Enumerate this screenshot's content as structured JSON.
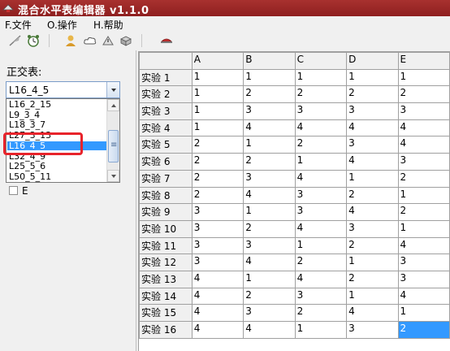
{
  "window": {
    "title": "混合水平表编辑器 v1.1.0"
  },
  "menu": [
    {
      "label": "F.文件"
    },
    {
      "label": "O.操作"
    },
    {
      "label": "H.帮助"
    }
  ],
  "toolbar": {
    "icons": [
      "feather-icon",
      "alarm-clock-icon",
      "user-icon",
      "cloud-icon",
      "warning-icon",
      "box-icon",
      "cap-icon"
    ]
  },
  "left_panel": {
    "label": "正交表:",
    "combo_value": "L16_4_5",
    "dropdown_items": [
      "L16_2_15",
      "L9_3_4",
      "L18_3_7",
      "L27_3_13",
      "L16_4_5",
      "L32_4_9",
      "L25_5_6",
      "L50_5_11"
    ],
    "dropdown_selected": "L16_4_5",
    "checkbox_label": "E",
    "checkbox_checked": false
  },
  "grid": {
    "columns": [
      "A",
      "B",
      "C",
      "D",
      "E"
    ],
    "rows": [
      {
        "label": "实验 1",
        "values": [
          "1",
          "1",
          "1",
          "1",
          "1"
        ]
      },
      {
        "label": "实验 2",
        "values": [
          "1",
          "2",
          "2",
          "2",
          "2"
        ]
      },
      {
        "label": "实验 3",
        "values": [
          "1",
          "3",
          "3",
          "3",
          "3"
        ]
      },
      {
        "label": "实验 4",
        "values": [
          "1",
          "4",
          "4",
          "4",
          "4"
        ]
      },
      {
        "label": "实验 5",
        "values": [
          "2",
          "1",
          "2",
          "3",
          "4"
        ]
      },
      {
        "label": "实验 6",
        "values": [
          "2",
          "2",
          "1",
          "4",
          "3"
        ]
      },
      {
        "label": "实验 7",
        "values": [
          "2",
          "3",
          "4",
          "1",
          "2"
        ]
      },
      {
        "label": "实验 8",
        "values": [
          "2",
          "4",
          "3",
          "2",
          "1"
        ]
      },
      {
        "label": "实验 9",
        "values": [
          "3",
          "1",
          "3",
          "4",
          "2"
        ]
      },
      {
        "label": "实验 10",
        "values": [
          "3",
          "2",
          "4",
          "3",
          "1"
        ]
      },
      {
        "label": "实验 11",
        "values": [
          "3",
          "3",
          "1",
          "2",
          "4"
        ]
      },
      {
        "label": "实验 12",
        "values": [
          "3",
          "4",
          "2",
          "1",
          "3"
        ]
      },
      {
        "label": "实验 13",
        "values": [
          "4",
          "1",
          "4",
          "2",
          "3"
        ]
      },
      {
        "label": "实验 14",
        "values": [
          "4",
          "2",
          "3",
          "1",
          "4"
        ]
      },
      {
        "label": "实验 15",
        "values": [
          "4",
          "3",
          "2",
          "4",
          "1"
        ]
      },
      {
        "label": "实验 16",
        "values": [
          "4",
          "4",
          "1",
          "3",
          "2"
        ]
      }
    ],
    "selected_cell": {
      "row": 15,
      "col": 4
    }
  },
  "colors": {
    "titlebar": "#9a2626",
    "selection": "#3399ff",
    "highlight": "#e8232b"
  }
}
